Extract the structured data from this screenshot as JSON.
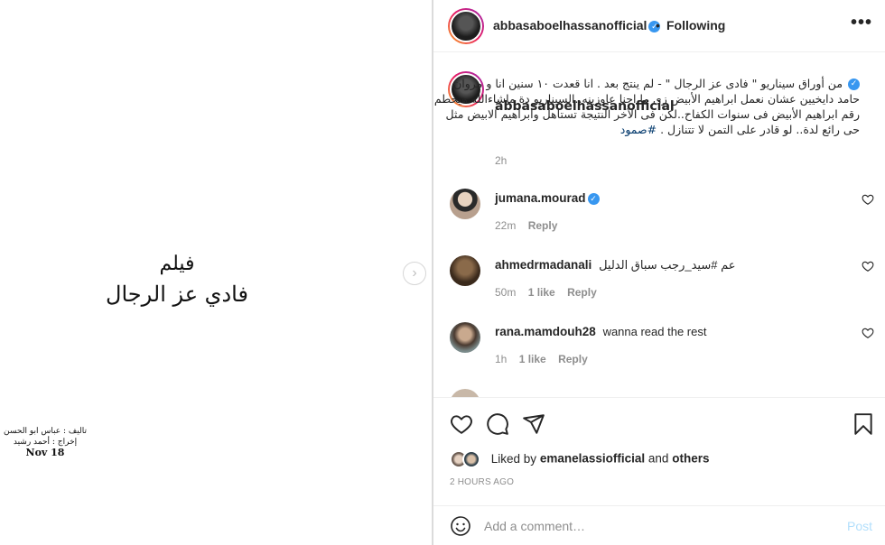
{
  "media": {
    "poster_line1": "فيلم",
    "poster_line2": "فادي عز الرجال",
    "credit_author": "تاليف : عباس ابو الحسن",
    "credit_director": "إخراج : أحمد رشيد",
    "credit_date": "Nov 18",
    "next_icon": "chevron-right-icon"
  },
  "header": {
    "username": "abbasaboelhassanofficial",
    "verified_icon": "✓",
    "separator": "•",
    "follow_label": "Following",
    "more_icon": "•••"
  },
  "caption": {
    "username": "abbasaboelhassanofficial",
    "verified_icon": "✓",
    "text": "من أوراق سيناريو \" فادى عز الرجال \" - لم ينتج بعد . انا قعدت ١٠ سنين انا و مروان حامد دايخيين عشان نعمل ابراهيم الأبيض زى ما احنا عاوزينه..السيناريو دة ماشاءالله هيحطم رقم ابراهيم الأبيض فى سنوات الكفاح..لكن فى الآخر النتيجة تستاهل وابراهيم الابيض مثل حى رائع لدة.. لو قادر على التمن لا تتنازل . ",
    "hashtag": "#صمود",
    "time": "2h"
  },
  "comments": [
    {
      "username": "jumana.mourad",
      "verified": "✓",
      "text": "",
      "time": "22m",
      "likes": "",
      "reply": "Reply"
    },
    {
      "username": "ahmedrmadanali",
      "verified": "",
      "text": "عم #سيد_رجب سباق الدليل",
      "time": "50m",
      "likes": "1 like",
      "reply": "Reply"
    },
    {
      "username": "rana.mamdouh28",
      "verified": "",
      "text": "wanna read the rest",
      "time": "1h",
      "likes": "1 like",
      "reply": "Reply"
    }
  ],
  "actions": {
    "liked_by_prefix": "Liked by",
    "liked_by_user": "emanelassiofficial",
    "liked_by_and": "and",
    "liked_by_others": "others",
    "timestamp": "2 HOURS AGO"
  },
  "comment_box": {
    "placeholder": "Add a comment…",
    "post_label": "Post"
  },
  "colors": {
    "link": "#00376b",
    "verified": "#3897f0",
    "post_disabled": "#b2dffc",
    "muted": "#8e8e8e"
  }
}
